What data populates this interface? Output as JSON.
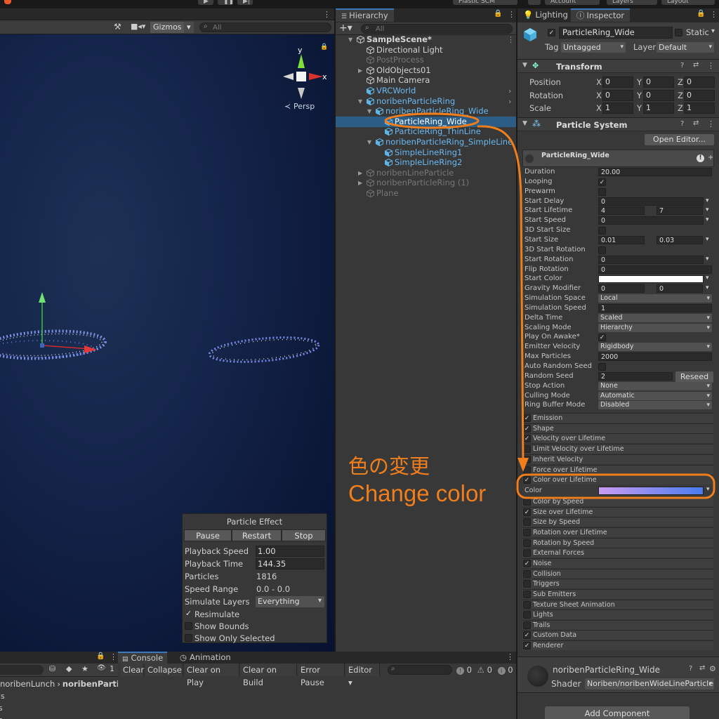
{
  "topbar": {
    "account": "Account",
    "layers": "Layers",
    "layout": "Layout",
    "plastic": "Plastic SCM"
  },
  "scene": {
    "gizmos_label": "Gizmos",
    "search_placeholder": "All",
    "axis_y": "y",
    "axis_x": "x",
    "persp_label": "Persp"
  },
  "particle_effect": {
    "title": "Particle Effect",
    "pause": "Pause",
    "restart": "Restart",
    "stop": "Stop",
    "rows": [
      {
        "label": "Playback Speed",
        "value": "1.00"
      },
      {
        "label": "Playback Time",
        "value": "144.35"
      },
      {
        "label": "Particles",
        "value": "1816"
      },
      {
        "label": "Speed Range",
        "value": "0.0 - 0.0"
      },
      {
        "label": "Simulate Layers",
        "value": "Everything"
      }
    ],
    "checks": [
      {
        "label": "Resimulate",
        "checked": true
      },
      {
        "label": "Show Bounds",
        "checked": false
      },
      {
        "label": "Show Only Selected",
        "checked": false
      }
    ]
  },
  "hierarchy": {
    "tab": "Hierarchy",
    "search_placeholder": "All",
    "items": [
      {
        "label": "SampleScene*",
        "depth": 0,
        "dim": false,
        "blue": false,
        "scene": true
      },
      {
        "label": "Directional Light",
        "depth": 1,
        "dim": false,
        "blue": false
      },
      {
        "label": "PostProcess",
        "depth": 1,
        "dim": true,
        "blue": false
      },
      {
        "label": "OldObjects01",
        "depth": 1,
        "dim": false,
        "blue": false,
        "arrow": true
      },
      {
        "label": "Main Camera",
        "depth": 1,
        "dim": false,
        "blue": false
      },
      {
        "label": "VRCWorld",
        "depth": 1,
        "dim": false,
        "blue": true
      },
      {
        "label": "noribenParticleRing",
        "depth": 1,
        "dim": false,
        "blue": true,
        "arrow": true
      },
      {
        "label": "noribenParticleRing_Wide",
        "depth": 2,
        "dim": false,
        "blue": true,
        "arrow": true
      },
      {
        "label": "ParticleRing_Wide",
        "depth": 3,
        "dim": false,
        "blue": true,
        "selected": true
      },
      {
        "label": "ParticleRing_ThinLine",
        "depth": 3,
        "dim": false,
        "blue": true
      },
      {
        "label": "noribenParticleRing_SimpleLine",
        "depth": 2,
        "dim": false,
        "blue": true,
        "arrow": true
      },
      {
        "label": "SimpleLineRing1",
        "depth": 3,
        "dim": false,
        "blue": true
      },
      {
        "label": "SimpleLineRing2",
        "depth": 3,
        "dim": false,
        "blue": true
      },
      {
        "label": "noribenLineParticle",
        "depth": 1,
        "dim": true,
        "blue": false,
        "arrow": true
      },
      {
        "label": "noribenParticleRing (1)",
        "depth": 1,
        "dim": true,
        "blue": false,
        "arrow": true
      },
      {
        "label": "Plane",
        "depth": 1,
        "dim": true,
        "blue": false
      }
    ]
  },
  "inspector": {
    "tab_lighting": "Lighting",
    "tab_inspector": "Inspector",
    "object_name": "ParticleRing_Wide",
    "static_label": "Static",
    "tag_label": "Tag",
    "tag_value": "Untagged",
    "layer_label": "Layer",
    "layer_value": "Default",
    "transform": {
      "title": "Transform",
      "rows": [
        {
          "label": "Position",
          "x": "0",
          "y": "0",
          "z": "0"
        },
        {
          "label": "Rotation",
          "x": "0",
          "y": "0",
          "z": "0"
        },
        {
          "label": "Scale",
          "x": "1",
          "y": "1",
          "z": "1"
        }
      ]
    },
    "particle_system": {
      "title": "Particle System",
      "open_editor": "Open Editor...",
      "sub_title": "ParticleRing_Wide",
      "props": [
        {
          "label": "Duration",
          "v1": "20.00"
        },
        {
          "label": "Looping",
          "check": true
        },
        {
          "label": "Prewarm",
          "check": false
        },
        {
          "label": "Start Delay",
          "v1": "0",
          "dd": true
        },
        {
          "label": "Start Lifetime",
          "v1": "4",
          "v2": "7",
          "dd": true
        },
        {
          "label": "Start Speed",
          "v1": "0",
          "dd": true
        },
        {
          "label": "3D Start Size",
          "check": false
        },
        {
          "label": "Start Size",
          "v1": "0.01",
          "v2": "0.03",
          "dd": true
        },
        {
          "label": "3D Start Rotation",
          "check": false
        },
        {
          "label": "Start Rotation",
          "v1": "0",
          "dd": true
        },
        {
          "label": "Flip Rotation",
          "v1": "0"
        },
        {
          "label": "Start Color",
          "color": "#ffffff"
        },
        {
          "label": "Gravity Modifier",
          "v1": "0",
          "v2": "0",
          "dd": true
        },
        {
          "label": "Simulation Space",
          "sel": "Local"
        },
        {
          "label": "Simulation Speed",
          "v1": "1"
        },
        {
          "label": "Delta Time",
          "sel": "Scaled"
        },
        {
          "label": "Scaling Mode",
          "sel": "Hierarchy"
        },
        {
          "label": "Play On Awake*",
          "check": true
        },
        {
          "label": "Emitter Velocity",
          "sel": "Rigidbody"
        },
        {
          "label": "Max Particles",
          "v1": "2000"
        },
        {
          "label": "Auto Random Seed",
          "check": false
        },
        {
          "label": "Random Seed",
          "v1": "2",
          "btn": "Reseed"
        },
        {
          "label": "Stop Action",
          "sel": "None"
        },
        {
          "label": "Culling Mode",
          "sel": "Automatic"
        },
        {
          "label": "Ring Buffer Mode",
          "sel": "Disabled"
        }
      ],
      "modules_a": [
        {
          "label": "Emission",
          "checked": true
        },
        {
          "label": "Shape",
          "checked": true
        },
        {
          "label": "Velocity over Lifetime",
          "checked": true
        },
        {
          "label": "Limit Velocity over Lifetime",
          "checked": false
        },
        {
          "label": "Inherit Velocity",
          "checked": false
        },
        {
          "label": "Force over Lifetime",
          "checked": false
        },
        {
          "label": "Color over Lifetime",
          "checked": true
        }
      ],
      "color_label": "Color",
      "modules_b": [
        {
          "label": "Color by Speed",
          "checked": false
        },
        {
          "label": "Size over Lifetime",
          "checked": true
        },
        {
          "label": "Size by Speed",
          "checked": false
        },
        {
          "label": "Rotation over Lifetime",
          "checked": false
        },
        {
          "label": "Rotation by Speed",
          "checked": false
        },
        {
          "label": "External Forces",
          "checked": false
        },
        {
          "label": "Noise",
          "checked": true
        },
        {
          "label": "Collision",
          "checked": false
        },
        {
          "label": "Triggers",
          "checked": false
        },
        {
          "label": "Sub Emitters",
          "checked": false
        },
        {
          "label": "Texture Sheet Animation",
          "checked": false
        },
        {
          "label": "Lights",
          "checked": false
        },
        {
          "label": "Trails",
          "checked": false
        },
        {
          "label": "Custom Data",
          "checked": true
        },
        {
          "label": "Renderer",
          "checked": true
        }
      ]
    },
    "material": {
      "name": "noribenParticleRing_Wide",
      "shader_label": "Shader",
      "shader_value": "Noriben/noribenWideLineParticle"
    },
    "add_component": "Add Component"
  },
  "project": {
    "breadcrumb_a": "noribenLunch",
    "breadcrumb_b": "noribenParticleRi",
    "hidden_count": "1",
    "items": [
      "ls",
      "s",
      "s"
    ]
  },
  "console": {
    "tab_console": "Console",
    "tab_animation": "Animation",
    "buttons": [
      "Clear",
      "Collapse",
      "Clear on Play",
      "Clear on Build",
      "Error Pause",
      "Editor"
    ],
    "err_count": "0",
    "warn_count": "0",
    "info_count": "0"
  },
  "annotation": {
    "jp": "色の変更",
    "en": "Change color",
    "color": "#f07e1c"
  },
  "colors": {
    "accent": "#3a79bb",
    "selection": "#2c5d87",
    "gradient_start": "#c99cf0",
    "gradient_end": "#4a7cf0"
  }
}
